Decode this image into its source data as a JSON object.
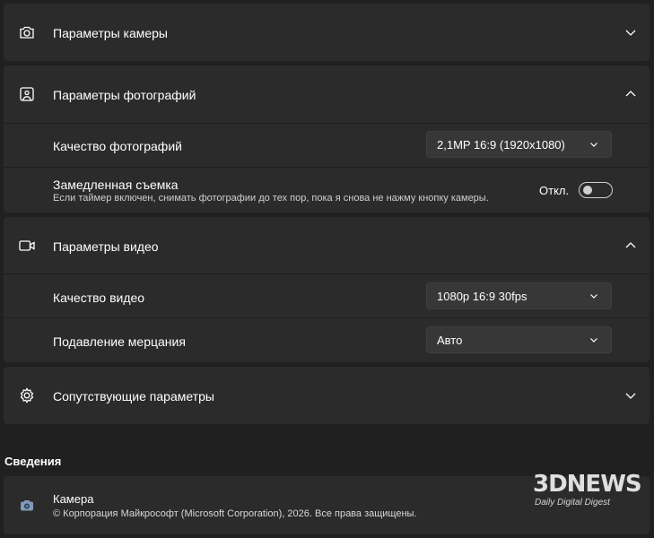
{
  "camera_settings": {
    "title": "Параметры камеры",
    "icon": "camera-icon"
  },
  "photo_settings": {
    "title": "Параметры фотографий",
    "icon": "image-icon",
    "quality": {
      "label": "Качество фотографий",
      "value": "2,1MP 16:9 (1920x1080)"
    },
    "slow_motion": {
      "label": "Замедленная съемка",
      "description": "Если таймер включен, снимать фотографии до тех пор, пока я снова не нажму кнопку камеры.",
      "state_label": "Откл.",
      "enabled": false
    }
  },
  "video_settings": {
    "title": "Параметры видео",
    "icon": "video-icon",
    "quality": {
      "label": "Качество видео",
      "value": "1080p 16:9 30fps"
    },
    "flicker": {
      "label": "Подавление мерцания",
      "value": "Авто"
    }
  },
  "related_settings": {
    "title": "Сопутствующие параметры",
    "icon": "gear-icon"
  },
  "about": {
    "heading": "Сведения",
    "app_name": "Камера",
    "copyright": "© Корпорация Майкрософт (Microsoft Corporation), 2026. Все права защищены."
  },
  "watermark": {
    "logo": "3DNEWS",
    "tagline": "Daily Digital Digest"
  },
  "colors": {
    "background": "#202020",
    "card": "#2b2b2b",
    "dropdown": "#373737"
  }
}
